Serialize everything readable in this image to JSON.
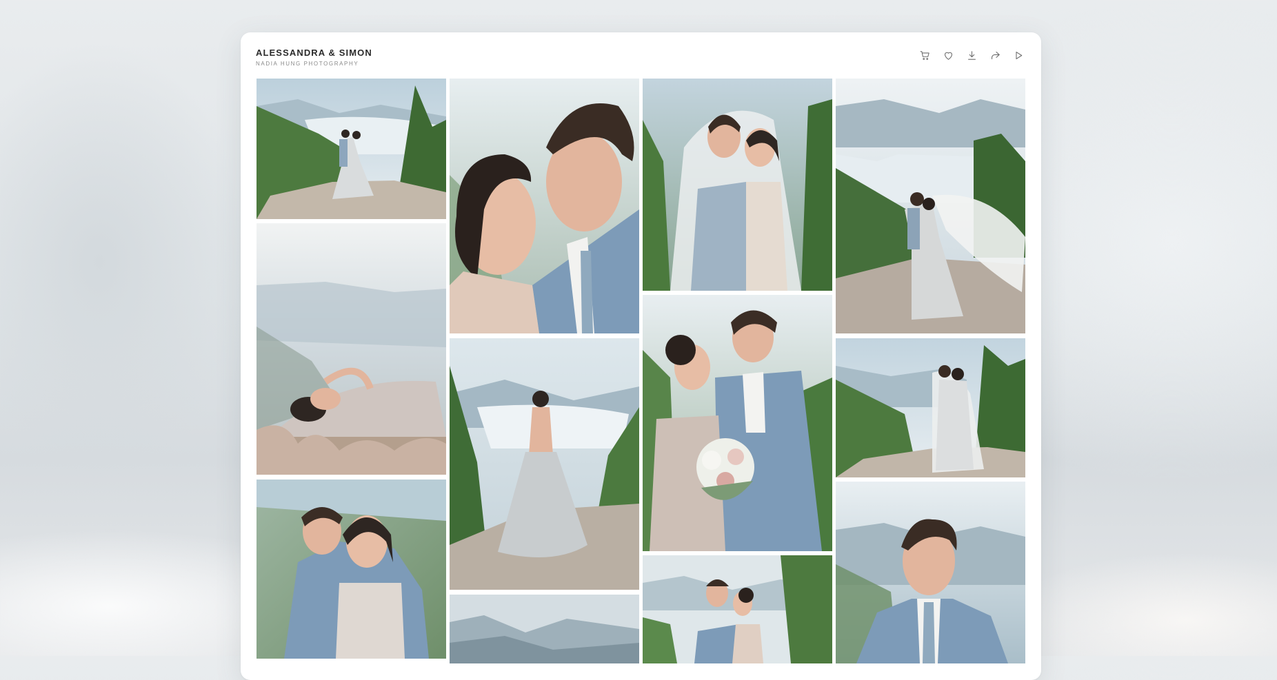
{
  "gallery": {
    "title": "ALESSANDRA & SIMON",
    "subtitle": "NADIA HUNG PHOTOGRAPHY"
  },
  "toolbar": {
    "buttons": [
      {
        "name": "cart-button",
        "icon": "cart-icon"
      },
      {
        "name": "favorite-button",
        "icon": "heart-icon"
      },
      {
        "name": "download-button",
        "icon": "download-icon"
      },
      {
        "name": "share-button",
        "icon": "share-icon"
      },
      {
        "name": "slideshow-button",
        "icon": "play-icon"
      }
    ]
  },
  "photos": [
    {
      "name": "photo-couple-embrace-cliff",
      "scene": "landscape-couple"
    },
    {
      "name": "photo-bride-lying-flowers",
      "scene": "bride-lying"
    },
    {
      "name": "photo-groom-hugging-bride",
      "scene": "hug-closeup"
    },
    {
      "name": "photo-couple-closeup-smile",
      "scene": "closeup"
    },
    {
      "name": "photo-bride-back-view",
      "scene": "bride-back"
    },
    {
      "name": "photo-mountain-lake-view",
      "scene": "landscape"
    },
    {
      "name": "photo-couple-under-veil",
      "scene": "veil"
    },
    {
      "name": "photo-couple-with-bouquet",
      "scene": "bouquet"
    },
    {
      "name": "photo-couple-kiss",
      "scene": "kiss"
    },
    {
      "name": "photo-couple-veil-wind",
      "scene": "veil-wind"
    },
    {
      "name": "photo-couple-veil-cliff",
      "scene": "veil-cliff"
    },
    {
      "name": "photo-groom-portrait",
      "scene": "groom"
    }
  ],
  "colors": {
    "sky": "#dfe8ee",
    "mountain": "#8aa4b3",
    "forest": "#4f7a3e",
    "rock": "#bdb3a6",
    "dress": "#c9cbcc",
    "suit": "#7d9bb8",
    "skin": "#e2b59d",
    "hair": "#2e2622"
  }
}
